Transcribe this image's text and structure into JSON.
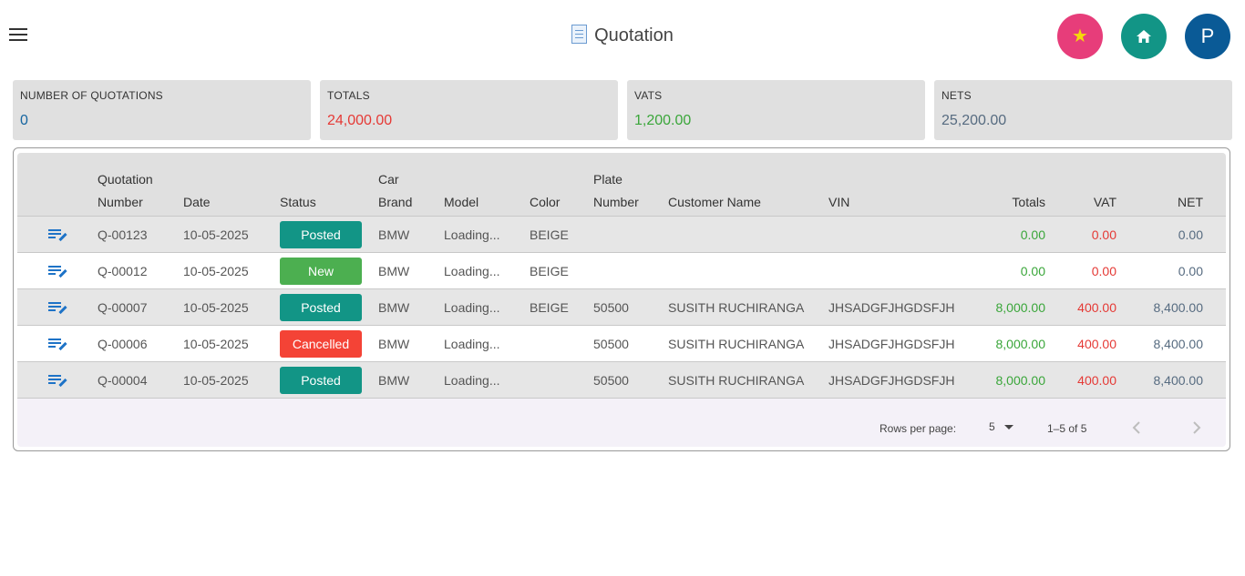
{
  "header": {
    "title": "Quotation",
    "avatar_letter": "P",
    "icons": [
      "menu-icon",
      "document-icon",
      "star-icon",
      "home-icon"
    ]
  },
  "summary": [
    {
      "label": "NUMBER OF QUOTATIONS",
      "value": "0",
      "color": "#1565a0"
    },
    {
      "label": "TOTALS",
      "value": "24,000.00",
      "color": "#e53935"
    },
    {
      "label": "VATS",
      "value": "1,200.00",
      "color": "#3aa63a"
    },
    {
      "label": "NETS",
      "value": "25,200.00",
      "color": "#566b80"
    }
  ],
  "table": {
    "columns": {
      "quotation_number_line1": "Quotation",
      "quotation_number_line2": "Number",
      "date": "Date",
      "status": "Status",
      "car_brand_line1": "Car",
      "car_brand_line2": "Brand",
      "model": "Model",
      "color": "Color",
      "plate_number_line1": "Plate",
      "plate_number_line2": "Number",
      "customer_name": "Customer Name",
      "vin": "VIN",
      "totals": "Totals",
      "vat": "VAT",
      "net": "NET"
    },
    "rows": [
      {
        "number": "Q-00123",
        "date": "10-05-2025",
        "status": "Posted",
        "brand": "BMW",
        "model": "Loading...",
        "color": "BEIGE",
        "plate": "",
        "customer": "",
        "vin": "",
        "totals": "0.00",
        "vat": "0.00",
        "net": "0.00"
      },
      {
        "number": "Q-00012",
        "date": "10-05-2025",
        "status": "New",
        "brand": "BMW",
        "model": "Loading...",
        "color": "BEIGE",
        "plate": "",
        "customer": "",
        "vin": "",
        "totals": "0.00",
        "vat": "0.00",
        "net": "0.00"
      },
      {
        "number": "Q-00007",
        "date": "10-05-2025",
        "status": "Posted",
        "brand": "BMW",
        "model": "Loading...",
        "color": "BEIGE",
        "plate": "50500",
        "customer": "SUSITH RUCHIRANGA",
        "vin": "JHSADGFJHGDSFJH",
        "totals": "8,000.00",
        "vat": "400.00",
        "net": "8,400.00"
      },
      {
        "number": "Q-00006",
        "date": "10-05-2025",
        "status": "Cancelled",
        "brand": "BMW",
        "model": "Loading...",
        "color": "",
        "plate": "50500",
        "customer": "SUSITH RUCHIRANGA",
        "vin": "JHSADGFJHGDSFJH",
        "totals": "8,000.00",
        "vat": "400.00",
        "net": "8,400.00"
      },
      {
        "number": "Q-00004",
        "date": "10-05-2025",
        "status": "Posted",
        "brand": "BMW",
        "model": "Loading...",
        "color": "",
        "plate": "50500",
        "customer": "SUSITH RUCHIRANGA",
        "vin": "JHSADGFJHGDSFJH",
        "totals": "8,000.00",
        "vat": "400.00",
        "net": "8,400.00"
      }
    ]
  },
  "pagination": {
    "rows_per_page_label": "Rows per page:",
    "rows_per_page": "5",
    "range": "1–5 of 5"
  },
  "colors": {
    "posted": "#129586",
    "new": "#4caf50",
    "cancelled": "#f44336",
    "favorite": "#e73d7a",
    "home": "#129586",
    "avatar": "#0a5a96"
  }
}
